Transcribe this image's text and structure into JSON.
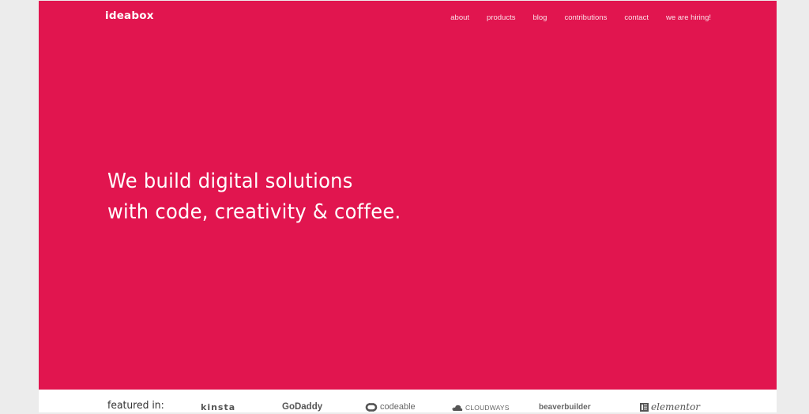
{
  "header": {
    "logo": "ideabox",
    "nav": [
      {
        "label": "about"
      },
      {
        "label": "products"
      },
      {
        "label": "blog"
      },
      {
        "label": "contributions"
      },
      {
        "label": "contact"
      },
      {
        "label": "we are hiring!"
      }
    ]
  },
  "hero": {
    "headline_line1": "We build digital solutions",
    "headline_line2": "with code, creativity & coffee."
  },
  "featured": {
    "label": "featured in:",
    "brands": [
      {
        "name": "kinsta",
        "icon": null
      },
      {
        "name": "GoDaddy",
        "icon": null
      },
      {
        "name": "codeable",
        "icon": "codeable-logo-icon"
      },
      {
        "name": "CLOUDWAYS",
        "icon": "cloud-icon"
      },
      {
        "name": "beaverbuilder",
        "icon": null
      },
      {
        "name": "elementor",
        "icon": "elementor-logo-icon"
      }
    ]
  },
  "colors": {
    "brand_red": "#e1154f",
    "page_background": "#ececec",
    "band_background": "#ffffff",
    "logo_gray": "#555555"
  }
}
